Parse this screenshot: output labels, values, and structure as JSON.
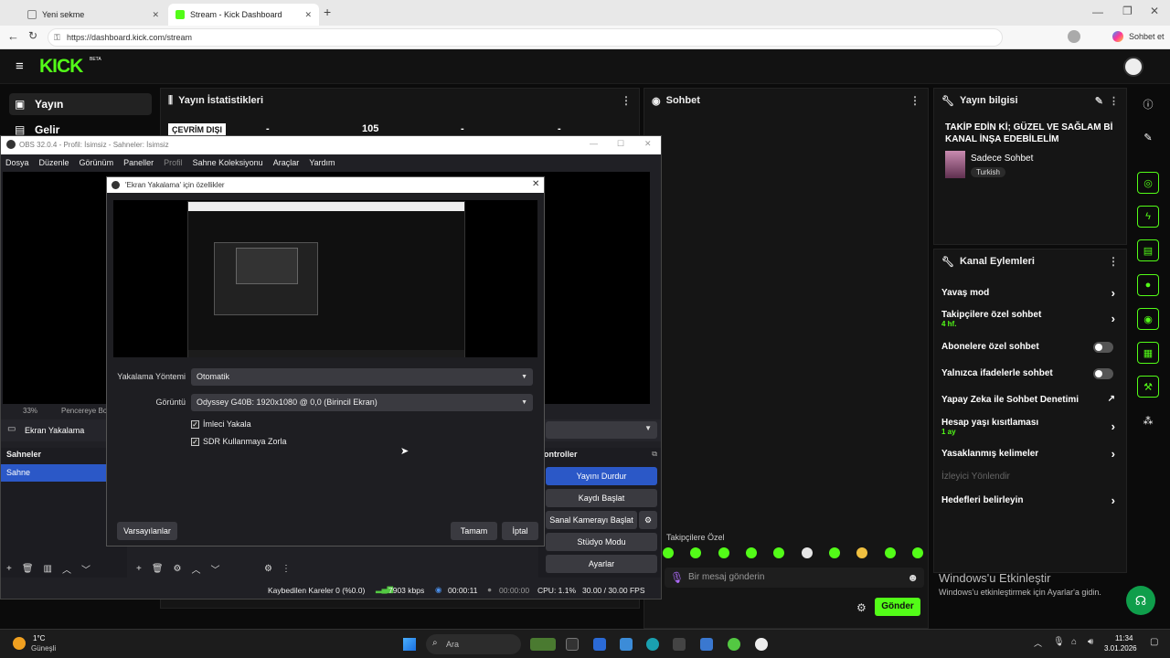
{
  "browser": {
    "tabs": [
      {
        "label": "Yeni sekme"
      },
      {
        "label": "Stream - Kick Dashboard"
      }
    ],
    "url": "https://dashboard.kick.com/stream",
    "copilot_label": "Sohbet et"
  },
  "kick": {
    "logo": "KICK",
    "beta": "BETA",
    "nav": [
      {
        "label": "Yayın"
      },
      {
        "label": "Gelir"
      }
    ],
    "stats": {
      "title": "Yayın İstatistikleri",
      "status": "ÇEVRİM DIŞI",
      "values": [
        "-",
        "105",
        "-",
        "-"
      ]
    },
    "chat": {
      "title": "Sohbet",
      "followers_only": "Takipçilere Özel",
      "placeholder": "Bir mesaj gönderin",
      "send": "Gönder"
    },
    "info": {
      "title": "Yayın bilgisi",
      "stream_title": "TAKİP EDİN Kİ; GÜZEL VE SAĞLAM Bİ KANAL İNŞA EDEBİLELİM",
      "category": "Sadece Sohbet",
      "tag": "Turkish"
    },
    "actions": {
      "title": "Kanal Eylemleri",
      "items": [
        {
          "label": "Yavaş mod"
        },
        {
          "label": "Takipçilere özel sohbet",
          "sub": "4 hf."
        },
        {
          "label": "Abonelere özel sohbet"
        },
        {
          "label": "Yalnızca ifadelerle sohbet"
        },
        {
          "label": "Yapay Zeka ile Sohbet Denetimi"
        },
        {
          "label": "Hesap yaşı kısıtlaması",
          "sub": "1 ay"
        },
        {
          "label": "Yasaklanmış kelimeler"
        },
        {
          "label": "İzleyici Yönlendir"
        },
        {
          "label": "Hedefleri belirleyin"
        }
      ]
    },
    "activation": {
      "title": "Windows'u Etkinleştir",
      "sub": "Windows'u etkinleştirmek için Ayarlar'a gidin."
    }
  },
  "obs": {
    "title": "OBS 32.0.4 - Profil: İsimsiz - Sahneler: İsimsiz",
    "menu": [
      "Dosya",
      "Düzenle",
      "Görünüm",
      "Paneller",
      "Profil",
      "Sahne Koleksiyonu",
      "Araçlar",
      "Yardım"
    ],
    "zoom": "33%",
    "window_fit": "Pencereye Boy",
    "source": "Ekran Yakalama",
    "scenes_title": "Sahneler",
    "scene": "Sahne",
    "controls_title": "ontroller",
    "controls": [
      "Yayını Durdur",
      "Kaydı Başlat",
      "Sanal Kamerayı Başlat",
      "Stüdyo Modu",
      "Ayarlar"
    ],
    "status": {
      "dropped": "Kaybedilen Kareler 0 (%0.0)",
      "kbps": "7903 kbps",
      "stream_time": "00:00:11",
      "rec_time": "00:00:00",
      "cpu": "CPU: 1.1%",
      "fps": "30.00 / 30.00 FPS"
    }
  },
  "dialog": {
    "title": "'Ekran Yakalama' için özellikler",
    "method_label": "Yakalama Yöntemi",
    "method_value": "Otomatik",
    "display_label": "Görüntü",
    "display_value": "Odyssey G40B: 1920x1080 @ 0,0 (Birincil Ekran)",
    "check1": "İmleci Yakala",
    "check2": "SDR Kullanmaya Zorla",
    "defaults": "Varsayılanlar",
    "ok": "Tamam",
    "cancel": "İptal"
  },
  "taskbar": {
    "temp": "1°C",
    "weather": "Güneşli",
    "search": "Ara",
    "time": "11:34",
    "date": "3.01.2026"
  }
}
